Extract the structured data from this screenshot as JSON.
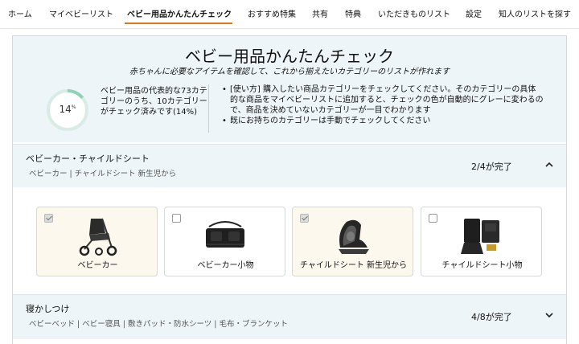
{
  "nav": {
    "tabs": [
      {
        "label": "ホーム"
      },
      {
        "label": "マイベビーリスト"
      },
      {
        "label": "ベビー用品かんたんチェック"
      },
      {
        "label": "おすすめ特集"
      },
      {
        "label": "共有"
      },
      {
        "label": "特典"
      },
      {
        "label": "いただきものリスト"
      },
      {
        "label": "設定"
      },
      {
        "label": "知人のリストを探す"
      }
    ],
    "active_index": 2
  },
  "header": {
    "title": "ベビー用品かんたんチェック",
    "subtitle": "赤ちゃんに必要なアイテムを確認して、これから揃えたいカテゴリーのリストが作れます",
    "progress_percent": 14,
    "progress_text": "14",
    "progress_unit": "%",
    "stat_text": "ベビー用品の代表的な73カテゴリーのうち、10カテゴリーがチェック済みです(14%)",
    "howto": [
      "[使い方] 購入したい商品カテゴリーをチェックしてください。そのカテゴリーの具体的な商品をマイベビーリストに追加すると、チェックの色が自動的にグレーに変わるので、商品を決めていないカテゴリーが一目でわかります",
      "既にお持ちのカテゴリーは手動でチェックしてください"
    ]
  },
  "categories": [
    {
      "name": "ベビーカー・チャイルドシート",
      "sub": "ベビーカー | チャイルドシート 新生児から",
      "status": "2/4が完了",
      "expanded": true,
      "items": [
        {
          "label": "ベビーカー",
          "checked": true,
          "icon": "stroller-icon"
        },
        {
          "label": "ベビーカー小物",
          "checked": false,
          "icon": "stroller-bag-icon"
        },
        {
          "label": "チャイルドシート 新生児から",
          "checked": true,
          "icon": "car-seat-icon"
        },
        {
          "label": "チャイルドシート小物",
          "checked": false,
          "icon": "seat-protector-icon"
        }
      ]
    },
    {
      "name": "寝かしつけ",
      "sub": "ベビーベッド | ベビー寝具 | 敷きパッド・防水シーツ | 毛布・ブランケット",
      "status": "4/8が完了",
      "expanded": false
    }
  ],
  "colors": {
    "accent": "#e47911",
    "progress_ring": "#8fd3b6",
    "progress_track": "#d9ece4",
    "panel_bg": "#eef5f8"
  }
}
